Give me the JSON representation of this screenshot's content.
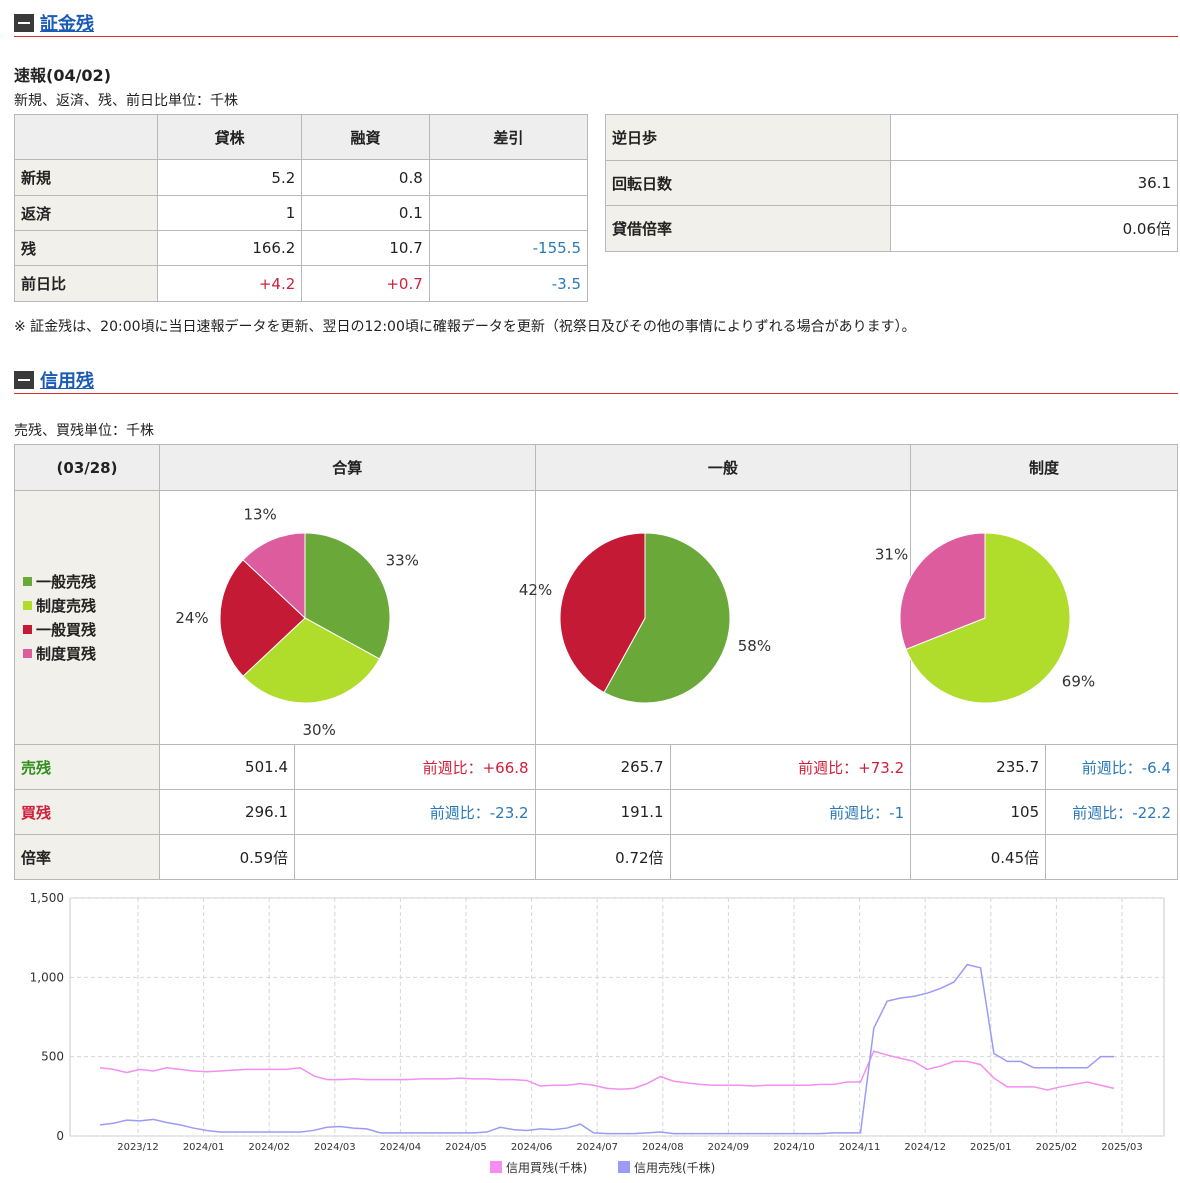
{
  "section1": {
    "title": "証金残"
  },
  "shoukin": {
    "heading": "速報(04/02)",
    "unit_note": "新規、返済、残、前日比単位：千株",
    "headers": [
      "貸株",
      "融資",
      "差引"
    ],
    "rows": [
      {
        "label": "新規",
        "lend": "5.2",
        "finance": "0.8",
        "diff": ""
      },
      {
        "label": "返済",
        "lend": "1",
        "finance": "0.1",
        "diff": ""
      },
      {
        "label": "残",
        "lend": "166.2",
        "finance": "10.7",
        "diff": "-155.5"
      },
      {
        "label": "前日比",
        "lend": "+4.2",
        "finance": "+0.7",
        "diff": "-3.5"
      }
    ],
    "side": [
      {
        "label": "逆日歩",
        "value": ""
      },
      {
        "label": "回転日数",
        "value": "36.1"
      },
      {
        "label": "貸借倍率",
        "value": "0.06倍"
      }
    ],
    "note": "※ 証金残は、20:00頃に当日速報データを更新、翌日の12:00頃に確報データを更新（祝祭日及びその他の事情によりずれる場合があります）。"
  },
  "section2": {
    "title": "信用残"
  },
  "shinyou": {
    "unit_note": "売残、買残単位：千株",
    "date": "(03/28)",
    "columns": [
      "合算",
      "一般",
      "制度"
    ],
    "legend": [
      "一般売残",
      "制度売残",
      "一般買残",
      "制度買残"
    ],
    "colors": {
      "ippan_uri": "#6aa83a",
      "seido_uri": "#b0dc2c",
      "ippan_kai": "#c41a35",
      "seido_kai": "#dd5c9e",
      "accent_red": "#e12d2d",
      "link_blue": "#1a5bb5",
      "line_buy": "#f48ef0",
      "line_sell": "#9b9bf5"
    },
    "pies": [
      {
        "name": "合算",
        "slices": [
          {
            "key": "ippan_uri",
            "label": "33%"
          },
          {
            "key": "seido_uri",
            "label": "30%"
          },
          {
            "key": "ippan_kai",
            "label": "24%"
          },
          {
            "key": "seido_kai",
            "label": "13%"
          }
        ]
      },
      {
        "name": "一般",
        "slices": [
          {
            "key": "ippan_uri",
            "label": "58%"
          },
          {
            "key": "ippan_kai",
            "label": "42%"
          }
        ]
      },
      {
        "name": "制度",
        "slices": [
          {
            "key": "seido_uri",
            "label": "69%"
          },
          {
            "key": "seido_kai",
            "label": "31%"
          }
        ]
      }
    ],
    "uri_label": "売残",
    "kai_label": "買残",
    "bai_label": "倍率",
    "uri": [
      {
        "v": "501.4",
        "c": "前週比：+66.8"
      },
      {
        "v": "265.7",
        "c": "前週比：+73.2"
      },
      {
        "v": "235.7",
        "c": "前週比：-6.4"
      }
    ],
    "kai": [
      {
        "v": "296.1",
        "c": "前週比：-23.2"
      },
      {
        "v": "191.1",
        "c": "前週比：-1"
      },
      {
        "v": "105",
        "c": "前週比：-22.2"
      }
    ],
    "bai": [
      "0.59倍",
      "0.72倍",
      "0.45倍"
    ]
  },
  "chart_data": {
    "type": "line",
    "ylim": [
      0,
      1500
    ],
    "y_ticks": [
      "0",
      "500",
      "1,000",
      "1,500"
    ],
    "x_labels": [
      "2023/12",
      "2024/01",
      "2024/02",
      "2024/03",
      "2024/04",
      "2024/05",
      "2024/06",
      "2024/07",
      "2024/08",
      "2024/09",
      "2024/10",
      "2024/11",
      "2024/12",
      "2025/01",
      "2025/02",
      "2025/03"
    ],
    "series": [
      {
        "name": "信用買残(千株)",
        "color": "#f48ef0",
        "values": [
          430,
          420,
          400,
          420,
          410,
          430,
          420,
          410,
          405,
          410,
          415,
          420,
          420,
          420,
          420,
          430,
          380,
          355,
          355,
          360,
          355,
          355,
          355,
          355,
          360,
          360,
          360,
          365,
          360,
          360,
          355,
          355,
          350,
          315,
          320,
          320,
          330,
          320,
          300,
          295,
          300,
          330,
          375,
          345,
          335,
          325,
          320,
          320,
          320,
          315,
          320,
          320,
          320,
          320,
          325,
          325,
          340,
          340,
          535,
          510,
          490,
          470,
          420,
          440,
          470,
          470,
          450,
          365,
          310,
          310,
          310,
          290,
          310,
          325,
          340,
          320,
          300
        ]
      },
      {
        "name": "信用売残(千株)",
        "color": "#9b9bf5",
        "values": [
          70,
          80,
          100,
          95,
          105,
          85,
          70,
          50,
          35,
          25,
          25,
          25,
          25,
          25,
          25,
          25,
          35,
          55,
          60,
          50,
          45,
          20,
          20,
          20,
          20,
          20,
          20,
          20,
          20,
          25,
          55,
          40,
          35,
          45,
          40,
          50,
          75,
          20,
          15,
          15,
          15,
          20,
          25,
          15,
          15,
          15,
          15,
          15,
          15,
          15,
          15,
          15,
          15,
          15,
          15,
          20,
          20,
          20,
          680,
          850,
          870,
          880,
          900,
          930,
          970,
          1080,
          1060,
          520,
          470,
          470,
          430,
          430,
          430,
          430,
          430,
          500,
          500
        ]
      }
    ]
  }
}
